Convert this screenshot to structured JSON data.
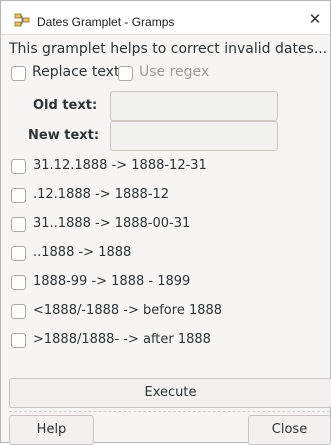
{
  "window": {
    "title": "Dates Gramplet - Gramps",
    "close_glyph": "✕",
    "icon": "gramps-icon"
  },
  "intro": "This gramplet helps to correct invalid dates...",
  "options": {
    "replace_text_label": "Replace text",
    "use_regex_label": "Use regex"
  },
  "fields": {
    "old_text_label": "Old text:",
    "old_text_value": "",
    "new_text_label": "New text:",
    "new_text_value": ""
  },
  "conversions": [
    "31.12.1888 -> 1888-12-31",
    ".12.1888 -> 1888-12",
    "31..1888 -> 1888-00-31",
    "..1888 -> 1888",
    "1888-99 -> 1888 - 1899",
    "<1888/-1888 -> before 1888",
    ">1888/1888- -> after 1888"
  ],
  "buttons": {
    "execute": "Execute",
    "help": "Help",
    "close": "Close"
  }
}
